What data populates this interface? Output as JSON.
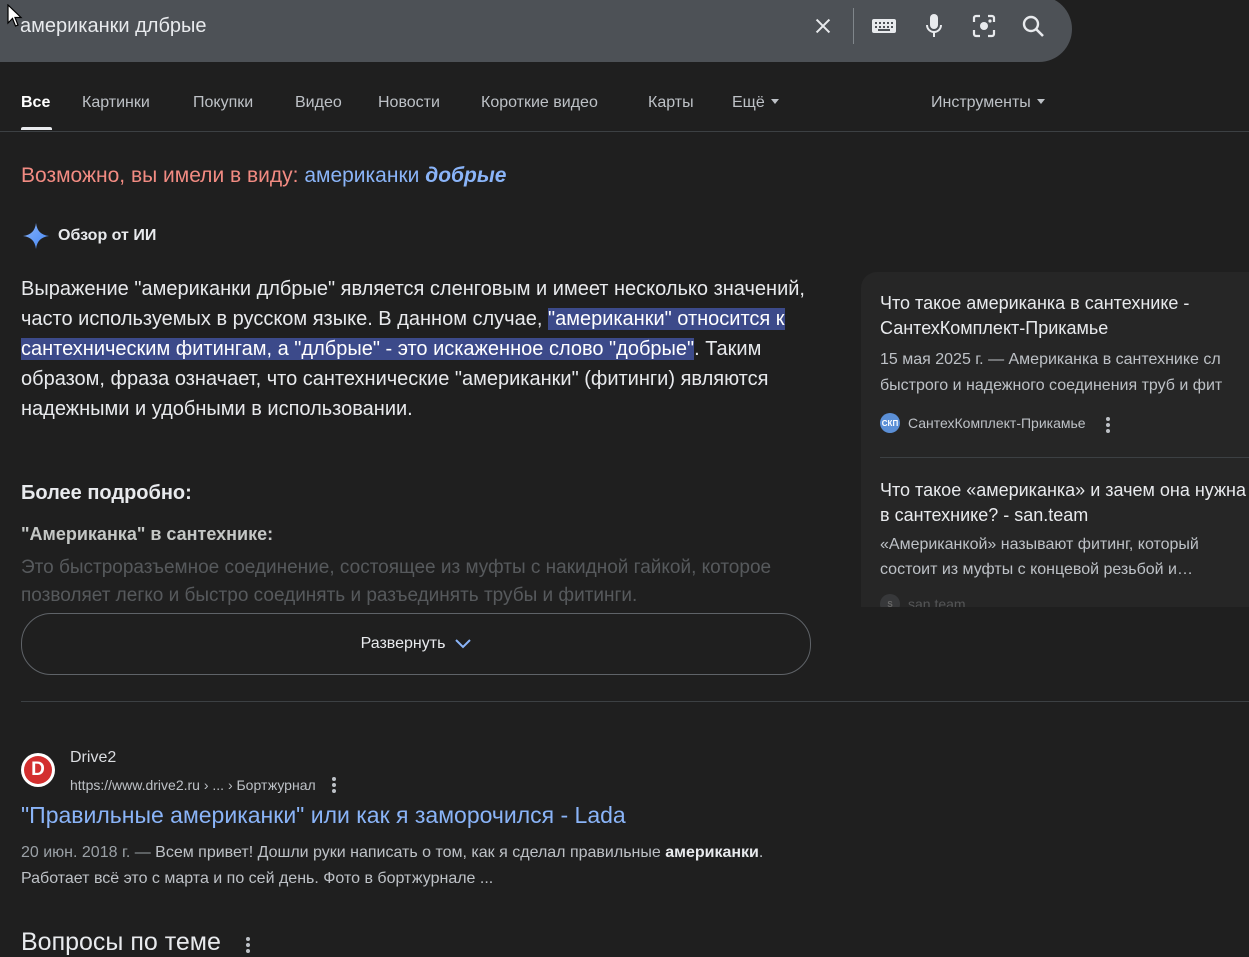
{
  "search": {
    "query": "американки длбрые",
    "clear_icon": "close-icon",
    "keyboard_icon": "keyboard-icon",
    "mic_icon": "mic-icon",
    "lens_icon": "lens-icon",
    "search_icon": "search-icon"
  },
  "tabs": {
    "items": [
      "Все",
      "Картинки",
      "Покупки",
      "Видео",
      "Новости",
      "Короткие видео",
      "Карты",
      "Ещё"
    ],
    "tools": "Инструменты"
  },
  "did_you_mean": {
    "prefix": "Возможно, вы имели в виду:",
    "word1": "американки",
    "word2": "добрые"
  },
  "ai_overview": {
    "title": "Обзор от ИИ",
    "text_part1": "Выражение \"американки длбрые\" является сленговым и имеет несколько значений, часто используемых в русском языке. В данном случае, ",
    "text_highlight": "\"американки\" относится к сантехническим фитингам, а \"длбрые\" - это искаженное слово \"добрые\"",
    "text_part2": ". Таким образом, фраза означает, что сантехнические \"американки\" (фитинги) являются надежными и удобными в использовании.",
    "more_heading": "Более подробно:",
    "sub_heading": "\"Американка\" в сантехнике:",
    "faded_text": "Это быстроразъемное соединение, состоящее из муфты с накидной гайкой, которое позволяет легко и быстро соединять и разъединять трубы и фитинги.",
    "expand_label": "Развернуть"
  },
  "sources": [
    {
      "title": "Что такое американка в сантехнике - СантехКомплект-Прикамье",
      "snippet_line1": "15 мая 2025 г. — Американка в сантехнике сл",
      "snippet_line2": "быстрого и надежного соединения труб и фит",
      "site": "СантехКомплект-Прикамье",
      "favicon_text": "СКП"
    },
    {
      "title": "Что такое «американка» и зачем она нужна в сантехнике? - san.team",
      "snippet_line1": "«Американкой» называют фитинг, который",
      "snippet_line2": "состоит из муфты с концевой резьбой и…",
      "site": "san.team",
      "favicon_text": "S"
    }
  ],
  "result": {
    "site": "Drive2",
    "url": "https://www.drive2.ru › ... › Бортжурнал",
    "favicon_letter": "D",
    "title": "\"Правильные американки\" или как я заморочился - Lada",
    "date": "20 июн. 2018 г. —",
    "snippet_a": " Всем привет! Дошли руки написать о том, как я сделал правильные ",
    "snippet_bold": "американки",
    "snippet_b": ".",
    "snippet_line2": "Работает всё это с марта и по сей день. Фото в бортжурнале ..."
  },
  "people_also_ask": "Вопросы по теме"
}
